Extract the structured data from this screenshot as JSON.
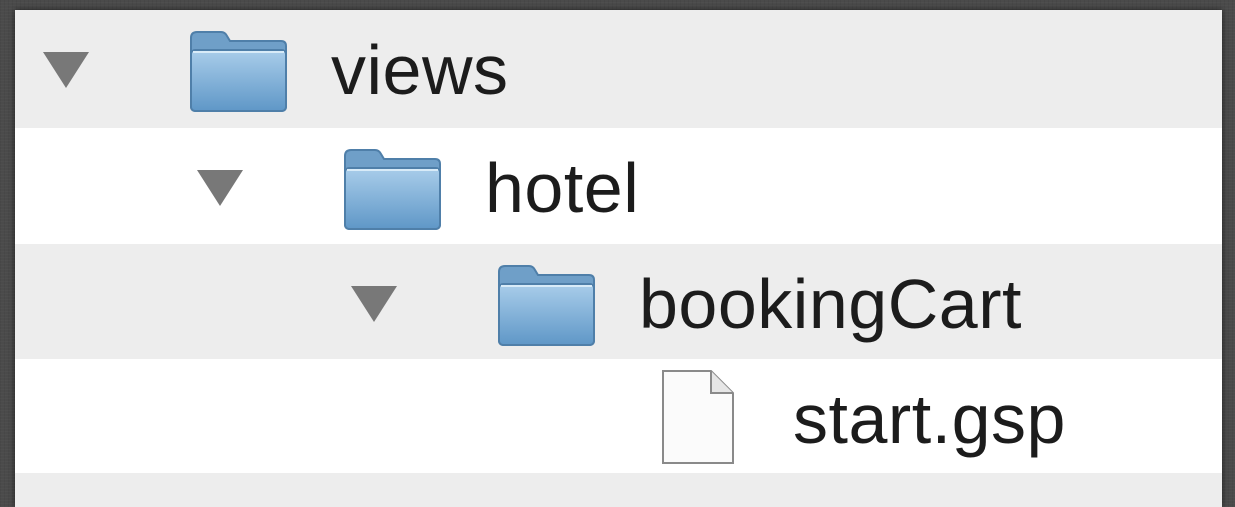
{
  "tree": {
    "items": [
      {
        "label": "views",
        "type": "folder",
        "icon": "folder-icon",
        "expanded": true,
        "level": 0
      },
      {
        "label": "hotel",
        "type": "folder",
        "icon": "folder-icon",
        "expanded": true,
        "level": 1
      },
      {
        "label": "bookingCart",
        "type": "folder",
        "icon": "folder-icon",
        "expanded": true,
        "level": 2
      },
      {
        "label": "start.gsp",
        "type": "file",
        "icon": "file-icon",
        "level": 3
      }
    ]
  },
  "colors": {
    "row_alt": "#ededed",
    "row": "#ffffff",
    "folder_blue": "#7fb0d8",
    "disclosure": "#787878"
  }
}
